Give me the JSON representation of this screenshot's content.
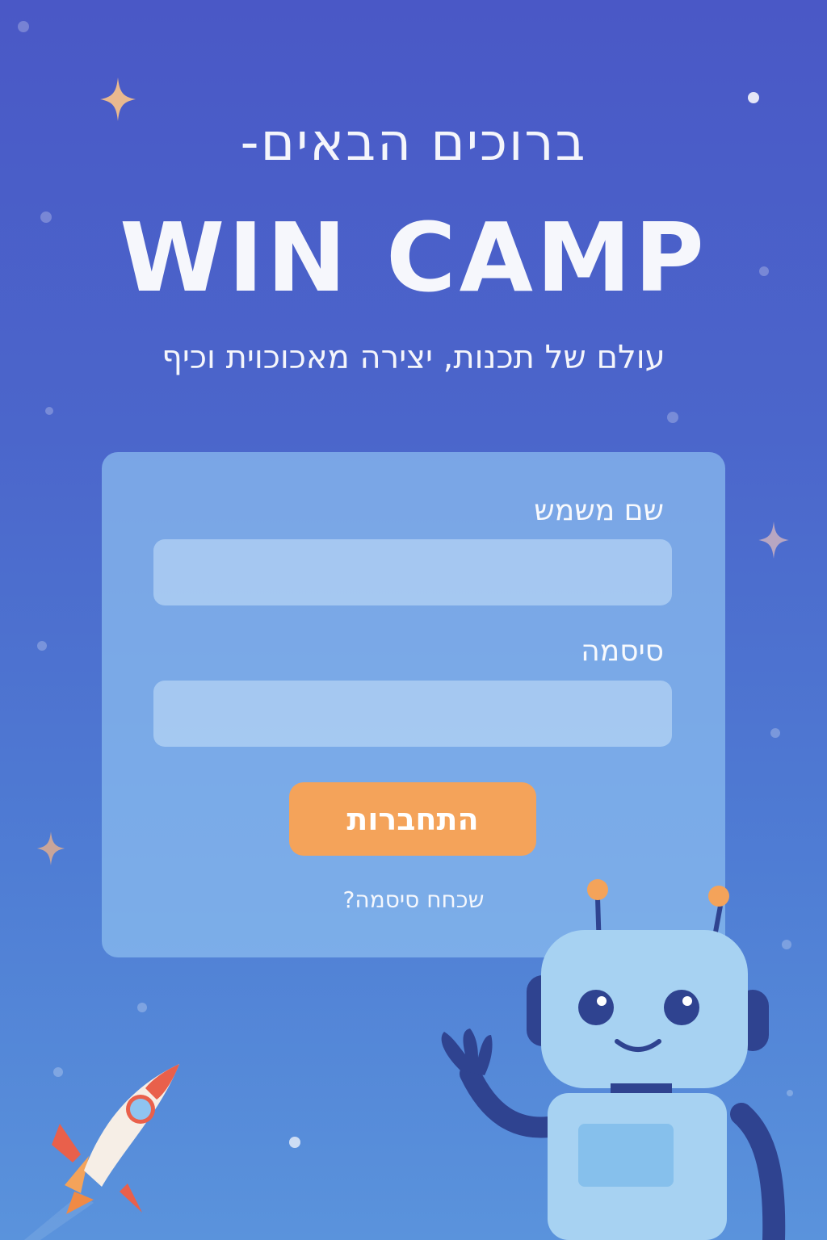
{
  "header": {
    "welcome": "ברוכים הבאים-",
    "brand": "WIN CAMP",
    "tagline": "עולם של תכנות, יצירה מאכוכוית וכיף"
  },
  "form": {
    "username_label": "שם משמש",
    "username_value": "",
    "password_label": "סיסמה",
    "password_value": "",
    "login_label": "התחברות",
    "forgot_label": "שכחח סיסמה?"
  },
  "colors": {
    "background_top": "#4a58c6",
    "background_bottom": "#5a93dc",
    "card": "#8cbef0",
    "button": "#f4a35a",
    "sparkle": "#e9b98f"
  },
  "icons": [
    "sparkle-icon",
    "robot-icon",
    "rocket-icon"
  ]
}
